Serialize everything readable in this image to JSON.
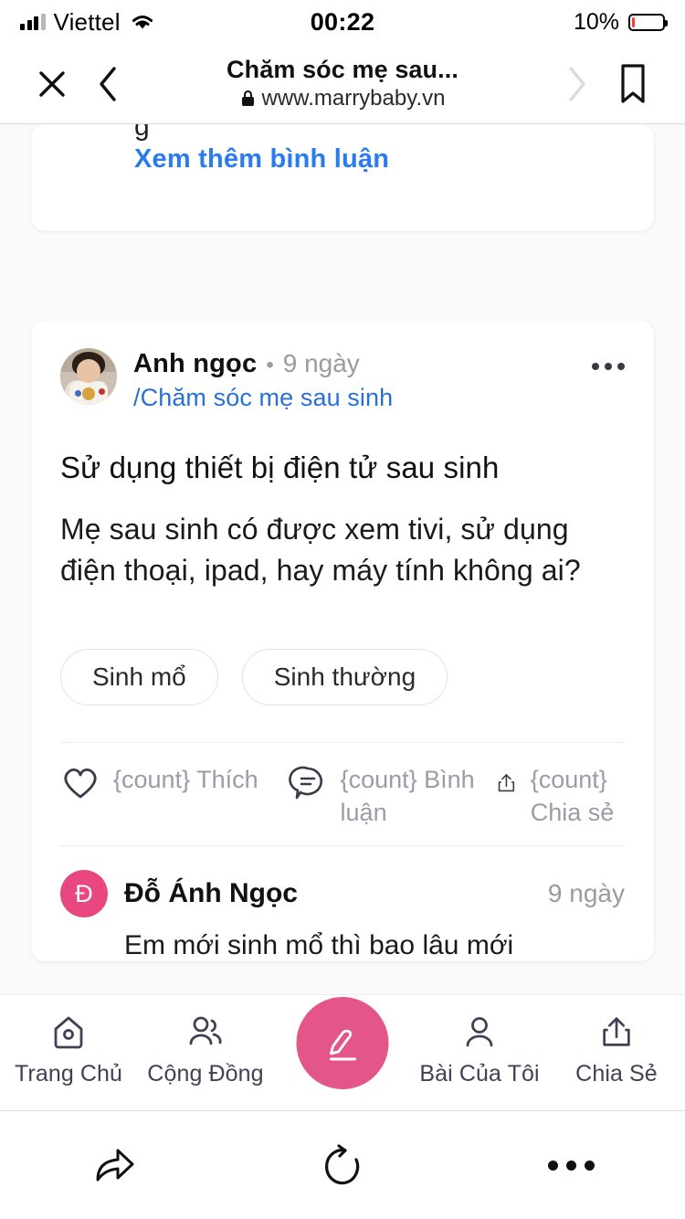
{
  "status_bar": {
    "carrier": "Viettel",
    "time": "00:22",
    "battery_percent": "10%",
    "signal_icon": "signal-bars-icon",
    "wifi_icon": "wifi-icon",
    "battery_icon": "battery-low-icon",
    "battery_fill_color": "#ff3b30"
  },
  "browser_bar": {
    "close_icon": "close-icon",
    "back_icon": "chevron-left-icon",
    "forward_icon": "chevron-right-icon",
    "bookmark_icon": "bookmark-icon",
    "page_title": "Chăm sóc mẹ sau...",
    "lock_icon": "lock-icon",
    "url": "www.marrybaby.vn"
  },
  "top_card": {
    "more_comments_label": "Xem thêm bình luận",
    "link_color": "#2a7bf0"
  },
  "post": {
    "author": "Anh ngọc",
    "separator": "•",
    "time_ago": "9 ngày",
    "topic": "/Chăm sóc mẹ sau sinh",
    "avatar_icon": "user-avatar-photo",
    "menu_icon": "kebab-menu-icon",
    "title": "Sử dụng thiết bị điện tử sau sinh",
    "body": "Mẹ sau sinh có được xem tivi, sử dụng điện thoại, ipad, hay máy tính không ai?",
    "tags": [
      "Sinh mổ",
      "Sinh thường"
    ],
    "actions": [
      {
        "icon": "heart-icon",
        "label": "{count} Thích"
      },
      {
        "icon": "comment-bubble-icon",
        "label": "{count} Bình luận"
      },
      {
        "icon": "share-upload-icon",
        "label": "{count} Chia sẻ"
      }
    ]
  },
  "comment": {
    "avatar_initial": "Đ",
    "avatar_color": "#e8477f",
    "name": "Đỗ Ánh Ngọc",
    "time_ago": "9 ngày"
  },
  "app_nav": {
    "accent_color": "#e4568a",
    "items": [
      {
        "icon": "home-icon",
        "label": "Trang Chủ"
      },
      {
        "icon": "community-users-icon",
        "label": "Cộng Đồng"
      },
      {
        "icon": "compose-pencil-icon",
        "label": ""
      },
      {
        "icon": "person-icon",
        "label": "Bài Của Tôi"
      },
      {
        "icon": "share-upload-icon",
        "label": "Chia Sẻ"
      }
    ]
  },
  "safari_toolbar": {
    "items": [
      {
        "icon": "forward-arrow-icon"
      },
      {
        "icon": "reload-icon"
      },
      {
        "icon": "more-dots-icon"
      }
    ]
  }
}
